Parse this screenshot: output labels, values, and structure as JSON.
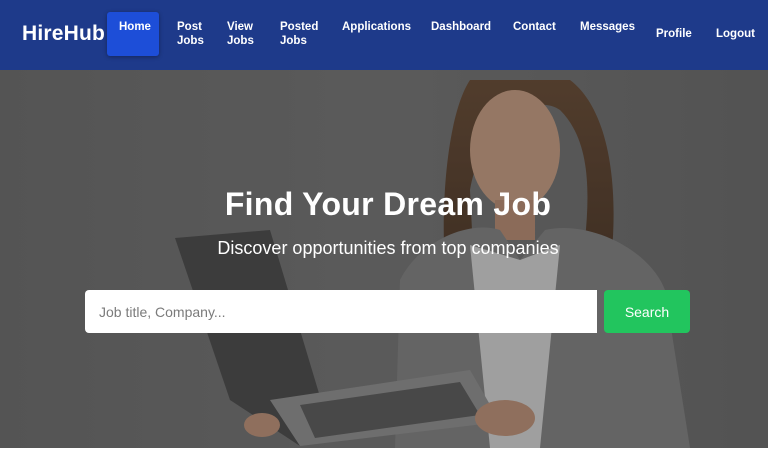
{
  "navbar": {
    "brand": "HireHub",
    "items": [
      {
        "line1": "Home",
        "line2": ""
      },
      {
        "line1": "Post",
        "line2": "Jobs"
      },
      {
        "line1": "View",
        "line2": "Jobs"
      },
      {
        "line1": "Posted",
        "line2": "Jobs"
      },
      {
        "line1": "Applications",
        "line2": ""
      },
      {
        "line1": "Dashboard",
        "line2": ""
      },
      {
        "line1": "Contact",
        "line2": ""
      },
      {
        "line1": "Messages",
        "line2": ""
      },
      {
        "line1": "Profile",
        "line2": ""
      },
      {
        "line1": "Logout",
        "line2": ""
      }
    ],
    "active_item": "Home"
  },
  "hero": {
    "title": "Find Your Dream Job",
    "subtitle": "Discover opportunities from top companies",
    "search": {
      "placeholder": "Job title, Company...",
      "value": "",
      "button_label": "Search"
    }
  },
  "colors": {
    "navbar_bg": "#1e3a8a",
    "active_nav_bg": "#1d4ed8",
    "search_button": "#22c55e"
  }
}
